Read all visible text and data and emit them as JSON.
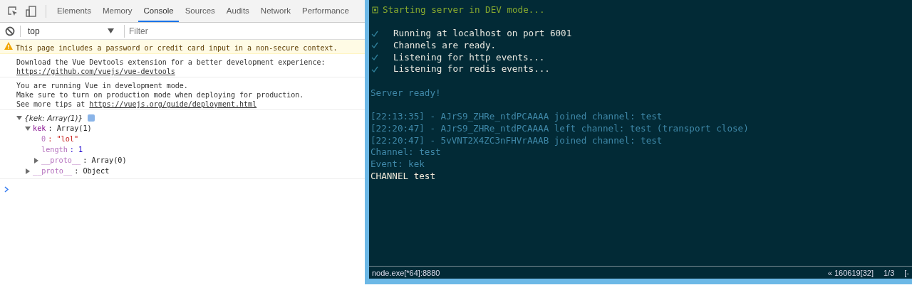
{
  "devtools": {
    "tabs": [
      {
        "label": "Elements",
        "selected": false
      },
      {
        "label": "Memory",
        "selected": false
      },
      {
        "label": "Console",
        "selected": true
      },
      {
        "label": "Sources",
        "selected": false
      },
      {
        "label": "Audits",
        "selected": false
      },
      {
        "label": "Network",
        "selected": false
      },
      {
        "label": "Performance",
        "selected": false
      }
    ],
    "context": "top",
    "filter": {
      "placeholder": "Filter"
    },
    "messages": [
      {
        "kind": "warning",
        "lines": [
          {
            "text": "This page includes a password or credit card input in a non-secure context."
          }
        ]
      },
      {
        "kind": "log",
        "lines": [
          {
            "text": "Download the Vue Devtools extension for a better development experience:"
          },
          {
            "link": "https://github.com/vuejs/vue-devtools"
          }
        ]
      },
      {
        "kind": "log",
        "lines": [
          {
            "text": "You are running Vue in development mode."
          },
          {
            "text": "Make sure to turn on production mode when deploying for production."
          },
          {
            "text": "See more tips at ",
            "link": "https://vuejs.org/guide/deployment.html"
          }
        ]
      }
    ],
    "object": {
      "label": "{kek: Array(1)}",
      "expanded": true,
      "children": [
        {
          "key": "kek",
          "value": ": Array(1)",
          "kind": "object",
          "dimmed": false,
          "expanded": true,
          "children": [
            {
              "key": "0",
              "value": ": \"lol\"",
              "kind": "string",
              "dimmed": true
            },
            {
              "key": "length",
              "value": ": 1",
              "kind": "number",
              "dimmed": true
            },
            {
              "key": "__proto__",
              "value": ": Array(0)",
              "kind": "object",
              "dimmed": true,
              "expanded": false
            }
          ]
        },
        {
          "key": "__proto__",
          "value": ": Object",
          "kind": "object",
          "dimmed": true,
          "expanded": false
        }
      ]
    }
  },
  "terminal": {
    "lines": [
      {
        "kind": "heading",
        "text": "Starting server in DEV mode..."
      },
      {
        "kind": "blank"
      },
      {
        "kind": "check",
        "text": "Running at localhost on port 6001"
      },
      {
        "kind": "check",
        "text": "Channels are ready."
      },
      {
        "kind": "check",
        "text": "Listening for http events..."
      },
      {
        "kind": "check",
        "text": "Listening for redis events..."
      },
      {
        "kind": "blank"
      },
      {
        "kind": "info",
        "text": "Server ready!"
      },
      {
        "kind": "blank"
      },
      {
        "kind": "info",
        "text": "[22:13:35] - AJrS9_ZHRe_ntdPCAAAA joined channel: test"
      },
      {
        "kind": "info",
        "text": "[22:20:47] - AJrS9_ZHRe_ntdPCAAAA left channel: test (transport close)"
      },
      {
        "kind": "info",
        "text": "[22:20:47] - 5vVNT2X4ZC3nFHVrAAAB joined channel: test"
      },
      {
        "kind": "info",
        "text": "Channel: test"
      },
      {
        "kind": "info",
        "text": "Event: kek"
      },
      {
        "kind": "plain",
        "text": "CHANNEL test"
      }
    ],
    "status_bar": {
      "process": "node.exe[*64]:8880",
      "position": "« 160619[32]",
      "page": "1/3",
      "column_3": "[-"
    }
  }
}
